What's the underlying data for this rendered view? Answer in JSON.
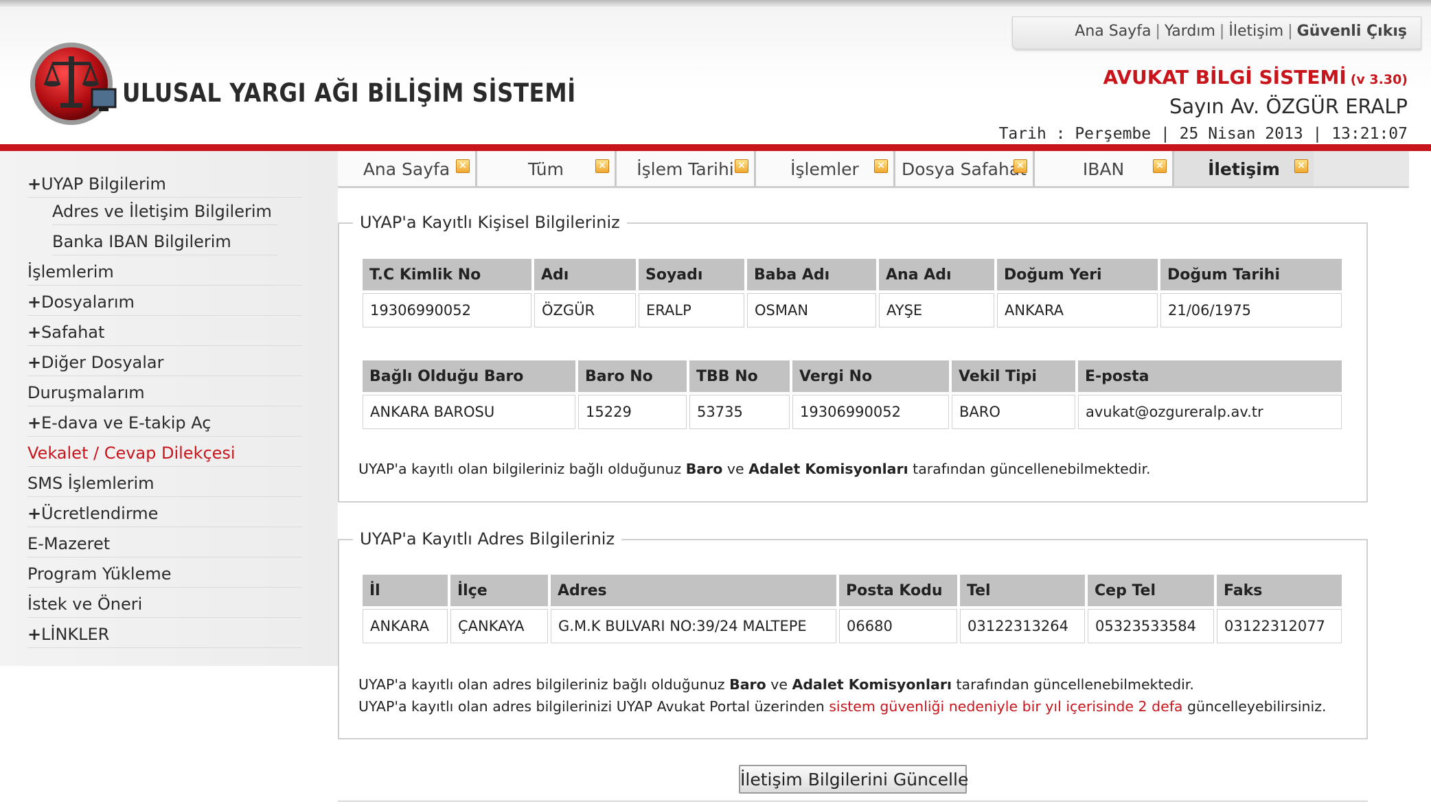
{
  "header": {
    "system_name": "ULUSAL YARGI AĞI BİLİŞİM SİSTEMİ",
    "top_links": [
      "Ana Sayfa",
      "Yardım",
      "İletişim",
      "Güvenli Çıkış"
    ],
    "app_name": "AVUKAT BİLGİ SİSTEMİ",
    "version": "(v 3.30)",
    "user": "Sayın Av. ÖZGÜR ERALP",
    "date_line": "Tarih : Perşembe | 25 Nisan 2013 | 13:21:07"
  },
  "sidebar": {
    "items": [
      {
        "label": "UYAP Bilgilerim",
        "plus": "+"
      },
      {
        "label": "Adres ve İletişim Bilgilerim"
      },
      {
        "label": "Banka IBAN Bilgilerim"
      },
      {
        "label": "İşlemlerim"
      },
      {
        "label": "Dosyalarım",
        "plus": "+"
      },
      {
        "label": "Safahat",
        "plus": "+"
      },
      {
        "label": "Diğer Dosyalar",
        "plus": "+"
      },
      {
        "label": "Duruşmalarım"
      },
      {
        "label": "E-dava ve E-takip Aç",
        "plus": "+"
      },
      {
        "label": "Vekalet / Cevap Dilekçesi"
      },
      {
        "label": "SMS İşlemlerim"
      },
      {
        "label": "Ücretlendirme",
        "plus": "+"
      },
      {
        "label": "E-Mazeret"
      },
      {
        "label": "Program Yükleme"
      },
      {
        "label": "İstek ve Öneri"
      },
      {
        "label": "LİNKLER",
        "plus": "+"
      }
    ]
  },
  "tabs": [
    "Ana Sayfa",
    "Tüm",
    "İşlem Tarihi",
    "İşlemler",
    "Dosya Safahat",
    "IBAN",
    "İletişim"
  ],
  "personal": {
    "legend": "UYAP'a Kayıtlı Kişisel Bilgileriniz",
    "table1": {
      "headers": [
        "T.C Kimlik No",
        "Adı",
        "Soyadı",
        "Baba Adı",
        "Ana Adı",
        "Doğum Yeri",
        "Doğum Tarihi"
      ],
      "row": [
        "19306990052",
        "ÖZGÜR",
        "ERALP",
        "OSMAN",
        "AYŞE",
        "ANKARA",
        "21/06/1975"
      ]
    },
    "table2": {
      "headers": [
        "Bağlı Olduğu Baro",
        "Baro No",
        "TBB No",
        "Vergi No",
        "Vekil Tipi",
        "E-posta"
      ],
      "row": [
        "ANKARA BAROSU",
        "15229",
        "53735",
        "19306990052",
        "BARO",
        "avukat@ozgureralp.av.tr"
      ]
    },
    "note": {
      "p1": "UYAP'a kayıtlı olan bilgileriniz bağlı olduğunuz ",
      "b1": "Baro",
      "p2": " ve ",
      "b2": "Adalet Komisyonları",
      "p3": " tarafından güncellenebilmektedir."
    }
  },
  "address": {
    "legend": "UYAP'a Kayıtlı Adres Bilgileriniz",
    "table": {
      "headers": [
        "İl",
        "İlçe",
        "Adres",
        "Posta Kodu",
        "Tel",
        "Cep Tel",
        "Faks"
      ],
      "row": [
        "ANKARA",
        "ÇANKAYA",
        "G.M.K BULVARI NO:39/24 MALTEPE",
        "06680",
        "03122313264",
        "05323533584",
        "03122312077"
      ]
    },
    "note1": {
      "p1": "UYAP'a kayıtlı olan adres bilgileriniz bağlı olduğunuz ",
      "b1": "Baro",
      "p2": " ve ",
      "b2": "Adalet Komisyonları",
      "p3": " tarafından güncellenebilmektedir."
    },
    "note2": {
      "p1": "UYAP'a kayıtlı olan adres bilgilerinizi UYAP Avukat Portal üzerinden ",
      "red": "sistem güvenliği nedeniyle bir yıl içerisinde 2 defa",
      "p2": " güncelleyebilirsiniz."
    }
  },
  "update_button": "İletişim Bilgilerini Güncelle"
}
